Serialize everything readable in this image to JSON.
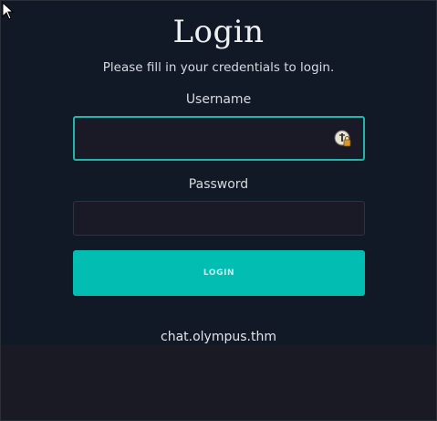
{
  "login": {
    "title": "Login",
    "subtitle": "Please fill in your credentials to login.",
    "username_label": "Username",
    "username_value": "",
    "password_label": "Password",
    "password_value": "",
    "button_label": "LOGIN",
    "footer_text": "chat.olympus.thm"
  },
  "colors": {
    "background": "#111826",
    "accent": "#02bdb2",
    "focus_border": "#1fb7ad",
    "input_bg": "#1a1a26"
  },
  "icons": {
    "password_manager": "password-manager-key-icon",
    "cursor": "mouse-pointer-icon"
  }
}
